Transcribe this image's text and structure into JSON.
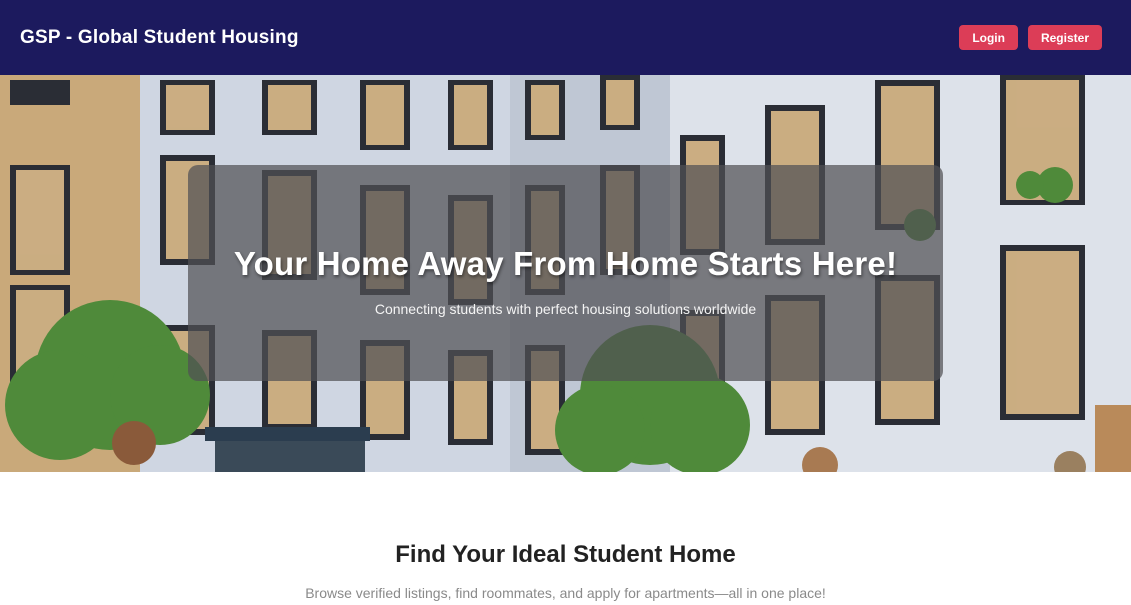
{
  "header": {
    "brand": "GSP - Global Student Housing",
    "login_label": "Login",
    "register_label": "Register"
  },
  "hero": {
    "image": "student-housing-building-photo",
    "title": "Your Home Away From Home Starts Here!",
    "subtitle": "Connecting students with perfect housing solutions worldwide"
  },
  "intro": {
    "title": "Find Your Ideal Student Home",
    "subtitle": "Browse verified listings, find roommates, and apply for apartments—all in one place!"
  },
  "colors": {
    "navbar": "#1c1a5e",
    "button": "#dc3d57",
    "overlay": "#505054"
  }
}
